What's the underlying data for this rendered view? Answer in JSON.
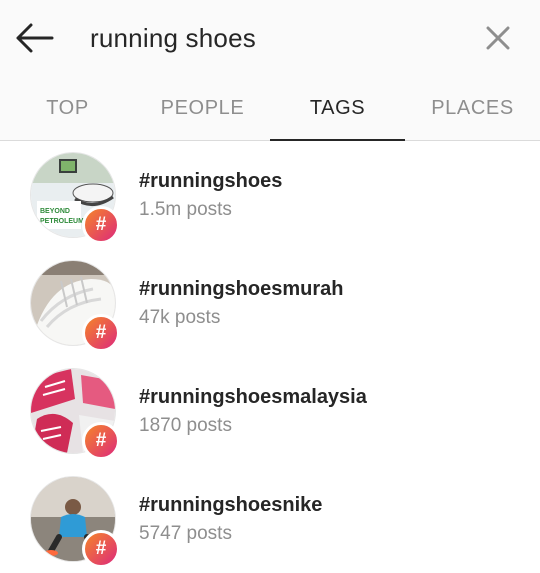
{
  "search": {
    "query": "running shoes"
  },
  "tabs": [
    {
      "label": "TOP",
      "active": false
    },
    {
      "label": "PEOPLE",
      "active": false
    },
    {
      "label": "TAGS",
      "active": true
    },
    {
      "label": "PLACES",
      "active": false
    }
  ],
  "results": [
    {
      "tag": "#runningshoes",
      "posts": "1.5m posts",
      "thumb_text": "BEYOND\nPETROLEUM",
      "badge": "#"
    },
    {
      "tag": "#runningshoesmurah",
      "posts": "47k posts",
      "badge": "#"
    },
    {
      "tag": "#runningshoesmalaysia",
      "posts": "1870 posts",
      "badge": "#"
    },
    {
      "tag": "#runningshoesnike",
      "posts": "5747 posts",
      "badge": "#"
    }
  ],
  "colors": {
    "badge_gradient_start": "#f58529",
    "badge_gradient_end": "#dd2a7b",
    "muted_text": "#8e8e8e",
    "primary_text": "#262626"
  }
}
